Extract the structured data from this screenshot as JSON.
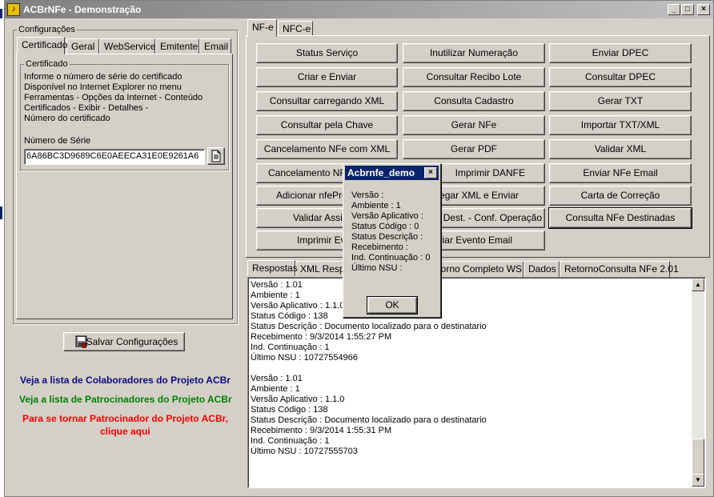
{
  "window": {
    "title": "ACBrNFe - Demonstração",
    "controls": {
      "minimize": "_",
      "maximize": "□",
      "close": "×"
    }
  },
  "left_panel": {
    "config_group": "Configurações",
    "tabs": [
      "Certificado",
      "Geral",
      "WebService",
      "Emitente",
      "Email"
    ],
    "cert_group": "Certificado",
    "cert_info": [
      "Informe o número de série do certificado",
      "Disponível no Internet Explorer no menu",
      "Ferramentas - Opções da Internet - Conteúdo",
      "Certificados - Exibir - Detalhes -",
      "Número do certificado"
    ],
    "serial_label": "Número de Série",
    "serial_value": "6A86BC3D9689C6E0AEECA31E0E9261A6",
    "save_button": "Salvar Configurações",
    "links": {
      "colaboradores": "Veja a lista de Colaboradores do Projeto ACBr",
      "patrocinadores": "Veja a lista de Patrocinadores do Projeto ACBr",
      "tornar_line1": "Para se tornar Patrocinador do Projeto ACBr,",
      "tornar_line2": "clique aqui"
    },
    "link_colors": {
      "colaboradores": "#0a0a80",
      "patrocinadores": "#008000",
      "tornar": "#ff0000"
    }
  },
  "right_panel": {
    "top_tabs": [
      "NF-e",
      "NFC-e"
    ],
    "buttons": {
      "status_servico": "Status Serviço",
      "inutilizar": "Inutilizar Numeração",
      "enviar_dpec": "Enviar DPEC",
      "criar_enviar": "Criar e Enviar",
      "consultar_recibo": "Consultar Recibo Lote",
      "consultar_dpec": "Consultar DPEC",
      "consultar_xml": "Consultar carregando XML",
      "consulta_cadastro": "Consulta Cadastro",
      "gerar_txt": "Gerar TXT",
      "consultar_chave": "Consultar pela Chave",
      "gerar_nfe": "Gerar NFe",
      "importar_txt": "Importar TXT/XML",
      "cancelamento_xml": "Cancelamento NFe com XML",
      "gerar_pdf": "Gerar PDF",
      "validar_xml": "Validar XML",
      "cancelamento_nfe": "Cancelamento NFe",
      "imprimir_danfe": "Imprimir DANFE",
      "enviar_email": "Enviar NFe Email",
      "adicionar_nfeproc": "Adicionar nfeProc",
      "carregar_xml_enviar": "Carregar XML e Enviar",
      "carta_correcao": "Carta de Correção",
      "validar_assinatura": "Validar Assin",
      "manif_dest": "Manif. Dest. - Conf. Operação",
      "consulta_destinadas": "Consulta NFe Destinadas",
      "imprimir_evento": "Imprimir Eve",
      "enviar_evento_email": "Enviar Evento Email"
    },
    "bottom_tabs": [
      "Respostas",
      "XML Resp",
      "Retorno Completo WS",
      "Dados",
      "RetornoConsulta NFe 2.01"
    ],
    "log_lines": [
      "Versão : 1.01",
      "Ambiente : 1",
      "Versão Aplicativo : 1.1.0",
      "Status Código : 138",
      "Status Descrição : Documento localizado para o destinatario",
      "Recebimento : 9/3/2014 1:55:27 PM",
      "Ind. Continuação : 1",
      "Último NSU : 10727554966",
      "",
      "Versão : 1.01",
      "Ambiente : 1",
      "Versão Aplicativo : 1.1.0",
      "Status Código : 138",
      "Status Descrição : Documento localizado para o destinatario",
      "Recebimento : 9/3/2014 1:55:31 PM",
      "Ind. Continuação : 1",
      "Último NSU : 10727555703"
    ]
  },
  "dialog": {
    "title": "Acbrnfe_demo",
    "close": "×",
    "lines": [
      "Versão :",
      "Ambiente : 1",
      "Versão Aplicativo :",
      "Status Código : 0",
      "Status Descrição :",
      "Recebimento :",
      "Ind. Continuação : 0",
      "Último NSU :"
    ],
    "ok": "OK"
  }
}
